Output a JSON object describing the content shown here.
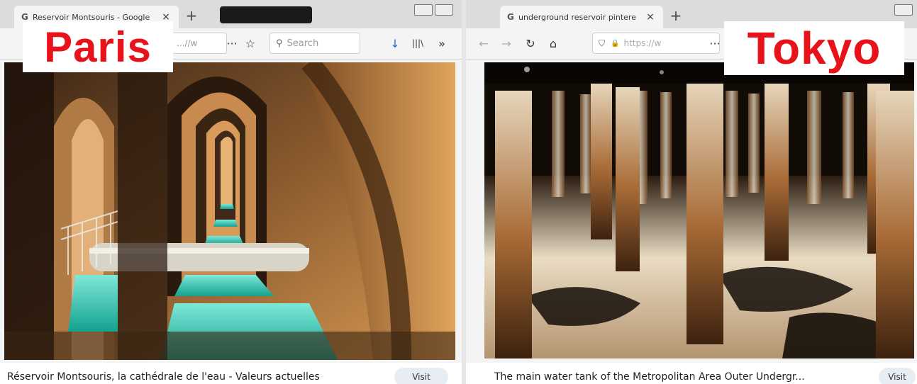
{
  "left": {
    "label": "Paris",
    "tab_title": "Reservoir Montsouris - Google",
    "tab_glyph": "G",
    "tab_close": "×",
    "new_tab": "+",
    "url_text": "...//w",
    "search_placeholder": "Search",
    "caption": "Réservoir Montsouris, la cathédrale de l'eau - Valeurs actuelles",
    "visit_label": "Visit"
  },
  "right": {
    "label": "Tokyo",
    "tab_title": "underground reservoir pintere",
    "tab_glyph": "G",
    "tab_close": "×",
    "new_tab": "+",
    "url_text": "https://w",
    "caption": "The main water tank of the Metropolitan Area Outer Undergr...",
    "visit_label": "Visit"
  },
  "icons": {
    "more": "···",
    "star": "☆",
    "search": "⚲",
    "download": "↓",
    "library": "|||\\",
    "overflow": "»",
    "back": "←",
    "forward": "→",
    "reload": "↻",
    "home": "⌂",
    "shield": "⛉",
    "lock": "🔒"
  },
  "colors": {
    "label_red": "#e8121b",
    "water_teal": "#2ec4b0",
    "stone_warm": "#c98a45",
    "tank_dark": "#1a120b",
    "pillar_light": "#e8d9c0"
  }
}
